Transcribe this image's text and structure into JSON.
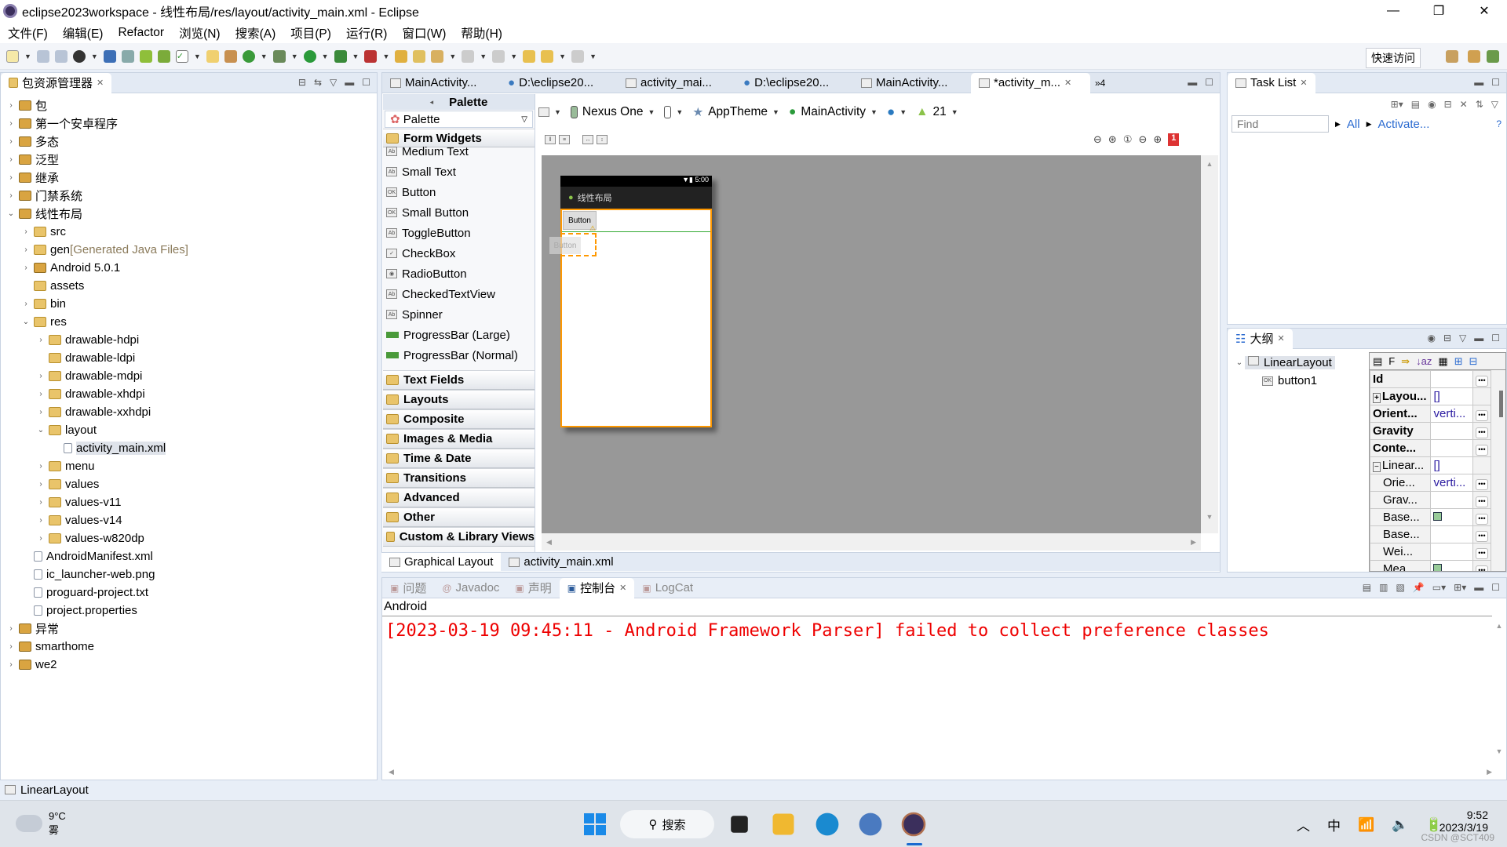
{
  "window": {
    "title": "eclipse2023workspace - 线性布局/res/layout/activity_main.xml - Eclipse",
    "min": "—",
    "max": "❐",
    "close": "✕"
  },
  "menu": [
    "文件(F)",
    "编辑(E)",
    "Refactor",
    "浏览(N)",
    "搜索(A)",
    "项目(P)",
    "运行(R)",
    "窗口(W)",
    "帮助(H)"
  ],
  "toolbar": {
    "quick_access": "快速访问"
  },
  "explorer": {
    "title": "包资源管理器",
    "items": [
      {
        "label": "包",
        "level": 0,
        "type": "proj",
        "tw": "›"
      },
      {
        "label": "第一个安卓程序",
        "level": 0,
        "type": "proj",
        "tw": "›"
      },
      {
        "label": "多态",
        "level": 0,
        "type": "proj",
        "tw": "›"
      },
      {
        "label": "泛型",
        "level": 0,
        "type": "proj",
        "tw": "›"
      },
      {
        "label": "继承",
        "level": 0,
        "type": "proj",
        "tw": "›"
      },
      {
        "label": "门禁系统",
        "level": 0,
        "type": "proj",
        "tw": "›"
      },
      {
        "label": "线性布局",
        "level": 0,
        "type": "proj",
        "tw": "⌄"
      },
      {
        "label": "src",
        "level": 1,
        "type": "folder",
        "tw": "›"
      },
      {
        "label": "gen",
        "suffix": " [Generated Java Files]",
        "level": 1,
        "type": "folder",
        "tw": "›"
      },
      {
        "label": "Android 5.0.1",
        "level": 1,
        "type": "proj",
        "tw": "›"
      },
      {
        "label": "assets",
        "level": 1,
        "type": "folder",
        "tw": ""
      },
      {
        "label": "bin",
        "level": 1,
        "type": "folder",
        "tw": "›"
      },
      {
        "label": "res",
        "level": 1,
        "type": "folder",
        "tw": "⌄"
      },
      {
        "label": "drawable-hdpi",
        "level": 2,
        "type": "folder",
        "tw": "›"
      },
      {
        "label": "drawable-ldpi",
        "level": 2,
        "type": "folder",
        "tw": ""
      },
      {
        "label": "drawable-mdpi",
        "level": 2,
        "type": "folder",
        "tw": "›"
      },
      {
        "label": "drawable-xhdpi",
        "level": 2,
        "type": "folder",
        "tw": "›"
      },
      {
        "label": "drawable-xxhdpi",
        "level": 2,
        "type": "folder",
        "tw": "›"
      },
      {
        "label": "layout",
        "level": 2,
        "type": "folder",
        "tw": "⌄"
      },
      {
        "label": "activity_main.xml",
        "level": 3,
        "type": "file",
        "tw": "",
        "selected": true
      },
      {
        "label": "menu",
        "level": 2,
        "type": "folder",
        "tw": "›"
      },
      {
        "label": "values",
        "level": 2,
        "type": "folder",
        "tw": "›"
      },
      {
        "label": "values-v11",
        "level": 2,
        "type": "folder",
        "tw": "›"
      },
      {
        "label": "values-v14",
        "level": 2,
        "type": "folder",
        "tw": "›"
      },
      {
        "label": "values-w820dp",
        "level": 2,
        "type": "folder",
        "tw": "›"
      },
      {
        "label": "AndroidManifest.xml",
        "level": 1,
        "type": "file",
        "tw": ""
      },
      {
        "label": "ic_launcher-web.png",
        "level": 1,
        "type": "file",
        "tw": ""
      },
      {
        "label": "proguard-project.txt",
        "level": 1,
        "type": "file",
        "tw": ""
      },
      {
        "label": "project.properties",
        "level": 1,
        "type": "file",
        "tw": ""
      },
      {
        "label": "异常",
        "level": 0,
        "type": "proj",
        "tw": "›"
      },
      {
        "label": "smarthome",
        "level": 0,
        "type": "proj",
        "tw": "›"
      },
      {
        "label": "we2",
        "level": 0,
        "type": "proj",
        "tw": "›"
      }
    ]
  },
  "editor": {
    "tabs": [
      "MainActivity...",
      "D:\\eclipse20...",
      "activity_mai...",
      "D:\\eclipse20...",
      "MainActivity...",
      "*activity_m..."
    ],
    "overflow": "»4",
    "bottom_tabs": [
      "Graphical Layout",
      "activity_main.xml"
    ]
  },
  "palette": {
    "header": "Palette",
    "selector": "Palette",
    "form_widgets": "Form Widgets",
    "items": [
      "Medium Text",
      "Small Text",
      "Button",
      "Small Button",
      "ToggleButton",
      "CheckBox",
      "RadioButton",
      "CheckedTextView",
      "Spinner",
      "ProgressBar (Large)",
      "ProgressBar (Normal)"
    ],
    "categories": [
      "Text Fields",
      "Layouts",
      "Composite",
      "Images & Media",
      "Time & Date",
      "Transitions",
      "Advanced",
      "Other",
      "Custom & Library Views"
    ]
  },
  "layout_toolbar": {
    "device": "Nexus One",
    "theme": "AppTheme",
    "activity": "MainActivity",
    "api": "21",
    "error_count": "1"
  },
  "phone": {
    "time": "5:00",
    "app_title": "线性布局",
    "button": "Button",
    "ghost_button": "Button"
  },
  "tasklist": {
    "title": "Task List",
    "find_placeholder": "Find",
    "all": "All",
    "activate": "Activate..."
  },
  "outline": {
    "title": "大纲",
    "root": "LinearLayout",
    "child": "button1"
  },
  "properties": {
    "header_f": "F",
    "rows": [
      {
        "name": "Id",
        "value": "",
        "bold": true
      },
      {
        "name": "Layou...",
        "value": "[]",
        "bold": true,
        "expander": "+"
      },
      {
        "name": "Orient...",
        "value": "verti...",
        "bold": true
      },
      {
        "name": "Gravity",
        "value": "",
        "bold": true
      },
      {
        "name": "Conte...",
        "value": "",
        "bold": true
      },
      {
        "name": "Linear...",
        "value": "[]",
        "expander": "−"
      },
      {
        "name": "Orie...",
        "value": "verti...",
        "indent": true
      },
      {
        "name": "Grav...",
        "value": "",
        "indent": true
      },
      {
        "name": "Base...",
        "value": "",
        "indent": true,
        "check": true
      },
      {
        "name": "Base...",
        "value": "",
        "indent": true
      },
      {
        "name": "Wei...",
        "value": "",
        "indent": true
      },
      {
        "name": "Mea...",
        "value": "",
        "indent": true,
        "check": true
      }
    ]
  },
  "console": {
    "tabs": [
      "问题",
      "Javadoc",
      "声明",
      "控制台",
      "LogCat"
    ],
    "active": 3,
    "header": "Android",
    "message": "[2023-03-19 09:45:11 - Android Framework Parser] failed to collect preference classes"
  },
  "status": {
    "text": "LinearLayout"
  },
  "taskbar": {
    "weather_temp": "9°C",
    "weather_desc": "雾",
    "search": "搜索",
    "ime": "中",
    "time": "9:52",
    "date": "2023/3/19",
    "watermark": "CSDN @SCT409"
  },
  "colors": {
    "error": "#e00000",
    "selection_orange": "#ff9800",
    "canvas": "#989898"
  }
}
